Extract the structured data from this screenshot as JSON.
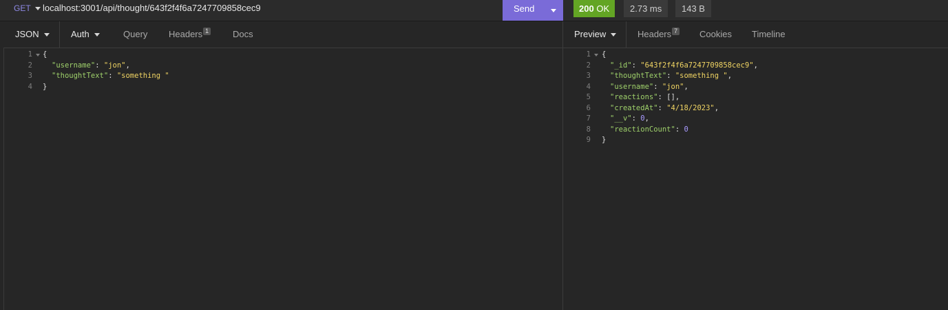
{
  "request": {
    "method": "GET",
    "url": "localhost:3001/api/thought/643f2f4f6a7247709858cec9",
    "send_label": "Send"
  },
  "response_meta": {
    "status_code": "200",
    "status_text": "OK",
    "time": "2.73 ms",
    "size": "143 B"
  },
  "request_tabs": {
    "body": "JSON",
    "auth": "Auth",
    "query": "Query",
    "headers": "Headers",
    "headers_count": "1",
    "docs": "Docs"
  },
  "response_tabs": {
    "preview": "Preview",
    "headers": "Headers",
    "headers_count": "7",
    "cookies": "Cookies",
    "timeline": "Timeline"
  },
  "request_body": {
    "line_numbers": [
      "1",
      "2",
      "3",
      "4"
    ],
    "open": "{",
    "close": "}",
    "fields": [
      {
        "key": "\"username\"",
        "value": "\"jon\"",
        "comma": ","
      },
      {
        "key": "\"thoughtText\"",
        "value": "\"something \"",
        "comma": ""
      }
    ]
  },
  "response_body": {
    "line_numbers": [
      "1",
      "2",
      "3",
      "4",
      "5",
      "6",
      "7",
      "8",
      "9"
    ],
    "open": "{",
    "close": "}",
    "fields": [
      {
        "key": "\"_id\"",
        "value": "\"643f2f4f6a7247709858cec9\"",
        "comma": ","
      },
      {
        "key": "\"thoughtText\"",
        "value": "\"something \"",
        "comma": ","
      },
      {
        "key": "\"username\"",
        "value": "\"jon\"",
        "comma": ","
      },
      {
        "key": "\"reactions\"",
        "value": "[]",
        "comma": ","
      },
      {
        "key": "\"createdAt\"",
        "value": "\"4/18/2023\"",
        "comma": ","
      },
      {
        "key": "\"__v\"",
        "value": "0",
        "comma": ","
      },
      {
        "key": "\"reactionCount\"",
        "value": "0",
        "comma": ""
      }
    ]
  },
  "colors": {
    "accent": "#7a6bd8",
    "status_ok": "#63a524",
    "json_key": "#9fd16b",
    "json_string": "#f0d463",
    "json_number": "#a99bff"
  }
}
